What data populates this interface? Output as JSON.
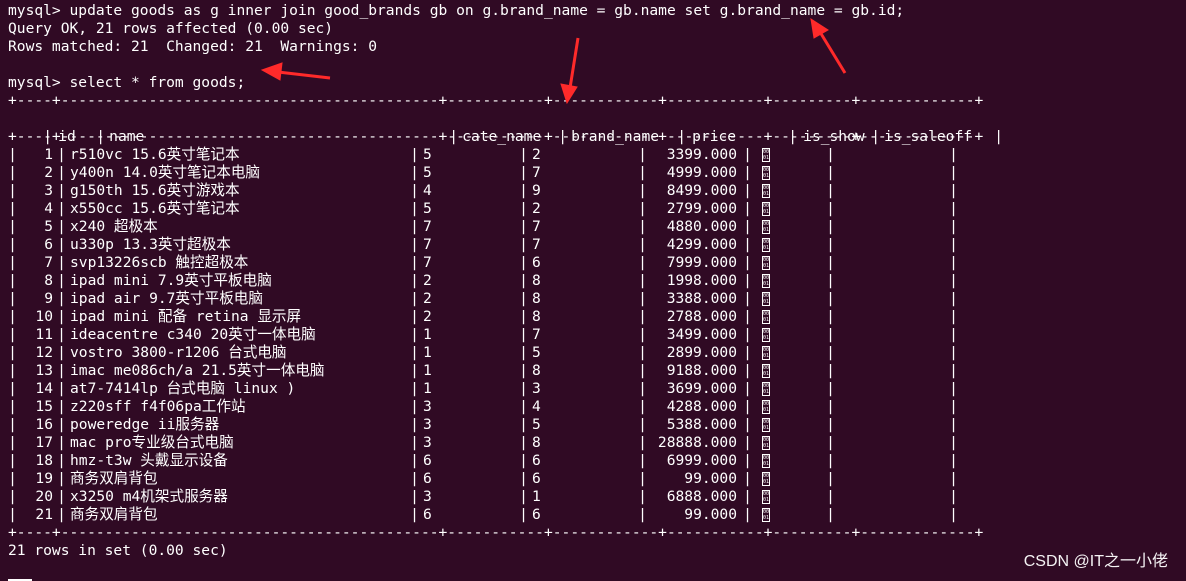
{
  "terminal": {
    "lines_top": [
      "mysql> update goods as g inner join good_brands gb on g.brand_name = gb.name set g.brand_name = gb.id;",
      "Query OK, 21 rows affected (0.00 sec)",
      "Rows matched: 21  Changed: 21  Warnings: 0"
    ],
    "select_line": "mysql> select * from goods;",
    "separator": "+----+-------------------------------------------+-----------+------------+-----------+---------+-------------+",
    "footer": "21 rows in set (0.00 sec)"
  },
  "table": {
    "columns": [
      "id",
      "name",
      "cate_name",
      "brand_name",
      "price",
      "is_show",
      "is_saleoff"
    ],
    "rows": [
      [
        "1",
        "r510vc 15.6英寸笔记本",
        "5",
        "2",
        "3399.000"
      ],
      [
        "2",
        "y400n 14.0英寸笔记本电脑",
        "5",
        "7",
        "4999.000"
      ],
      [
        "3",
        "g150th 15.6英寸游戏本",
        "4",
        "9",
        "8499.000"
      ],
      [
        "4",
        "x550cc 15.6英寸笔记本",
        "5",
        "2",
        "2799.000"
      ],
      [
        "5",
        "x240 超极本",
        "7",
        "7",
        "4880.000"
      ],
      [
        "6",
        "u330p 13.3英寸超极本",
        "7",
        "7",
        "4299.000"
      ],
      [
        "7",
        "svp13226scb 触控超极本",
        "7",
        "6",
        "7999.000"
      ],
      [
        "8",
        "ipad mini 7.9英寸平板电脑",
        "2",
        "8",
        "1998.000"
      ],
      [
        "9",
        "ipad air 9.7英寸平板电脑",
        "2",
        "8",
        "3388.000"
      ],
      [
        "10",
        "ipad mini 配备 retina 显示屏",
        "2",
        "8",
        "2788.000"
      ],
      [
        "11",
        "ideacentre c340 20英寸一体电脑",
        "1",
        "7",
        "3499.000"
      ],
      [
        "12",
        "vostro 3800-r1206 台式电脑",
        "1",
        "5",
        "2899.000"
      ],
      [
        "13",
        "imac me086ch/a 21.5英寸一体电脑",
        "1",
        "8",
        "9188.000"
      ],
      [
        "14",
        "at7-7414lp 台式电脑 linux )",
        "1",
        "3",
        "3699.000"
      ],
      [
        "15",
        "z220sff f4f06pa工作站",
        "3",
        "4",
        "4288.000"
      ],
      [
        "16",
        "poweredge ii服务器",
        "3",
        "5",
        "5388.000"
      ],
      [
        "17",
        "mac pro专业级台式电脑",
        "3",
        "8",
        "28888.000"
      ],
      [
        "18",
        "hmz-t3w 头戴显示设备",
        "6",
        "6",
        "6999.000"
      ],
      [
        "19",
        "商务双肩背包",
        "6",
        "6",
        "99.000"
      ],
      [
        "20",
        "x3250 m4机架式服务器",
        "3",
        "1",
        "6888.000"
      ],
      [
        "21",
        "商务双肩背包",
        "6",
        "6",
        "99.000"
      ]
    ],
    "binary_glyph": "0001"
  },
  "watermark": "CSDN @IT之一小佬",
  "colors": {
    "background": "#300a24",
    "text": "#ffffff",
    "arrow": "#ff2a2a"
  }
}
